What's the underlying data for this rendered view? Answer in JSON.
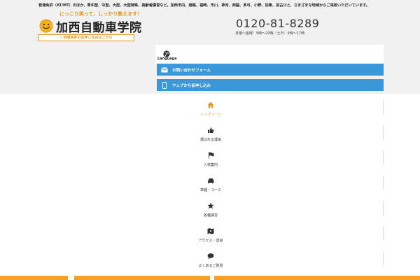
{
  "header": {
    "top_text": "普通免許（AT/MT）のほか、準中型、中型、大型、大型特殊、高齢者講習など。加西市内、姫路、福崎、市川、神河、西脇、多可、小野、加東、加古川と、さまざまな地域からご来校いただいています。",
    "tagline": "にっこり笑って、しっかり教えます！",
    "logo_text": "加西自動車学院",
    "course_button": "» 合宿免許のお申し込みはこちら",
    "phone": "0120-81-8289",
    "hours": "月曜〜金曜：9時〜20時／土日：9時〜17時"
  },
  "language": {
    "label": "Language"
  },
  "buttons": {
    "contact": "お問い合わせフォーム",
    "apply": "ウェブから仮申し込み"
  },
  "nav": {
    "items": [
      {
        "label": "トップページ",
        "icon": "home-icon"
      },
      {
        "label": "選ばれる理由",
        "icon": "thumbs-up-icon"
      },
      {
        "label": "入校案内",
        "icon": "flag-icon"
      },
      {
        "label": "車種・コース",
        "icon": "car-icon"
      },
      {
        "label": "各種講習",
        "icon": "star-icon"
      },
      {
        "label": "アクセス・送迎",
        "icon": "map-icon"
      },
      {
        "label": "よくあるご質問",
        "icon": "speech-bubble-icon"
      }
    ]
  },
  "colors": {
    "accent": "#e8961e",
    "button_blue": "#3a97d9",
    "header_bg": "#f1f1f1"
  }
}
